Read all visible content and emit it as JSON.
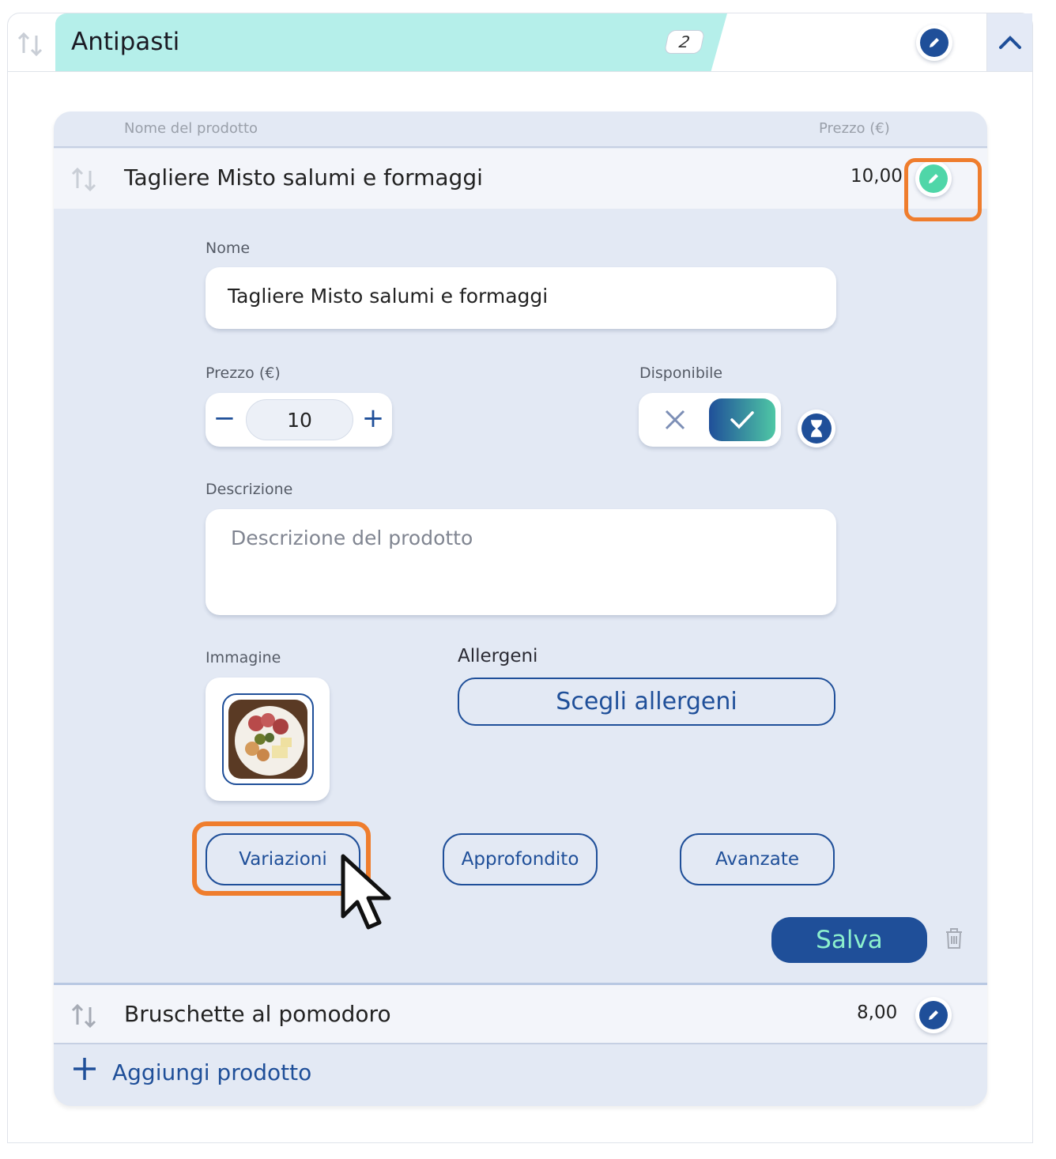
{
  "category": {
    "title": "Antipasti",
    "count": "2",
    "icons": {
      "sort": "sort-arrows-icon",
      "edit": "pencil-icon",
      "collapse": "chevron-up-icon"
    }
  },
  "table": {
    "col_name": "Nome del prodotto",
    "col_price": "Prezzo (€)"
  },
  "products": [
    {
      "name": "Tagliere Misto salumi e formaggi",
      "price": "10,00",
      "expanded": true
    },
    {
      "name": "Bruschette al pomodoro",
      "price": "8,00",
      "expanded": false
    }
  ],
  "editor": {
    "name_label": "Nome",
    "name_value": "Tagliere Misto salumi e formaggi",
    "price_label": "Prezzo (€)",
    "price_value": "10",
    "minus": "−",
    "plus": "+",
    "available_label": "Disponibile",
    "available": true,
    "description_label": "Descrizione",
    "description_placeholder": "Descrizione del prodotto",
    "image_label": "Immagine",
    "allergens_label": "Allergeni",
    "allergens_button": "Scegli allergeni",
    "tabs": [
      "Variazioni",
      "Approfondito",
      "Avanzate"
    ],
    "save": "Salva"
  },
  "add_product": "Aggiungi prodotto",
  "colors": {
    "accent": "#1f4f99",
    "category_tab": "#b5efea",
    "highlight": "#ef7d2d",
    "save_text": "#8cf0cd"
  }
}
